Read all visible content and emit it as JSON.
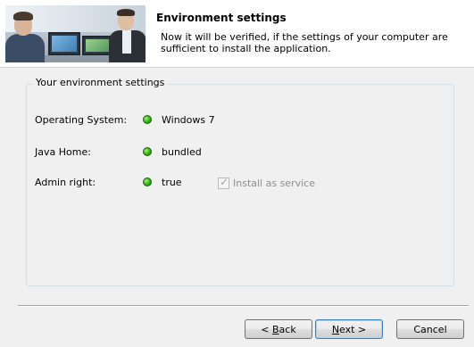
{
  "header": {
    "title": "Environment settings",
    "description": "Now it will  be verified, if the settings of your computer are sufficient to install the application."
  },
  "group": {
    "legend": "Your environment settings",
    "rows": [
      {
        "label": "Operating System:",
        "value": "Windows 7",
        "status": "ok"
      },
      {
        "label": "Java Home:",
        "value": "bundled",
        "status": "ok"
      },
      {
        "label": "Admin right:",
        "value": "true",
        "status": "ok"
      }
    ],
    "service_checkbox": {
      "label": "Install as service",
      "checked": true,
      "enabled": false
    }
  },
  "buttons": {
    "back_prefix": "< ",
    "back_mnemonic": "B",
    "back_rest": "ack",
    "next_mnemonic": "N",
    "next_rest": "ext >",
    "cancel": "Cancel"
  },
  "colors": {
    "status_ok": "#3bbd1f",
    "default_button_border": "#3c7fb1"
  }
}
